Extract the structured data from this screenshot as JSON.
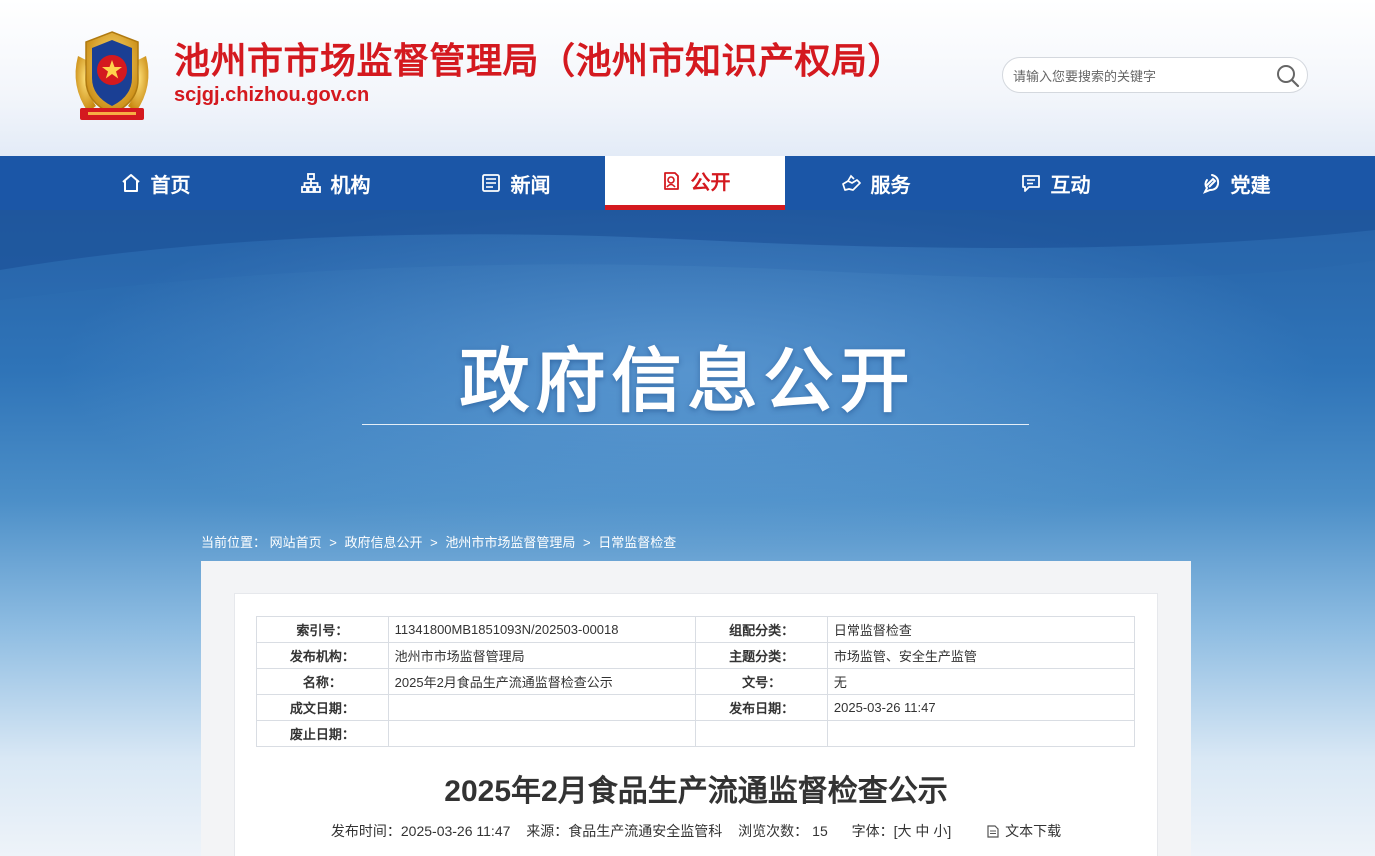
{
  "header": {
    "site_title": "池州市市场监督管理局（池州市知识产权局）",
    "site_url": "scjgj.chizhou.gov.cn",
    "search_placeholder": "请输入您要搜索的关键字"
  },
  "nav": {
    "items": [
      {
        "label": "首页",
        "icon": "home-icon"
      },
      {
        "label": "机构",
        "icon": "org-chart-icon"
      },
      {
        "label": "新闻",
        "icon": "newspaper-icon"
      },
      {
        "label": "公开",
        "icon": "open-info-icon",
        "active": true
      },
      {
        "label": "服务",
        "icon": "service-icon"
      },
      {
        "label": "互动",
        "icon": "chat-icon"
      },
      {
        "label": "党建",
        "icon": "party-icon"
      }
    ],
    "active_color": "#d4191f",
    "bar_color": "#1b56a7"
  },
  "banner": {
    "title": "政府信息公开"
  },
  "breadcrumb": {
    "prefix": "当前位置：",
    "items": [
      "网站首页",
      "政府信息公开",
      "池州市市场监督管理局",
      "日常监督检查"
    ],
    "separator": ">"
  },
  "meta_table": {
    "rows": [
      [
        {
          "k": "索引号：",
          "v": "11341800MB1851093N/202503-00018"
        },
        {
          "k": "组配分类：",
          "v": "日常监督检查"
        }
      ],
      [
        {
          "k": "发布机构：",
          "v": "池州市市场监督管理局"
        },
        {
          "k": "主题分类：",
          "v": "市场监管、安全生产监管"
        }
      ],
      [
        {
          "k": "名称：",
          "v": "2025年2月食品生产流通监督检查公示"
        },
        {
          "k": "文号：",
          "v": "无"
        }
      ],
      [
        {
          "k": "成文日期：",
          "v": ""
        },
        {
          "k": "发布日期：",
          "v": "2025-03-26 11:47"
        }
      ],
      [
        {
          "k": "废止日期：",
          "v": ""
        },
        {
          "k": "",
          "v": ""
        }
      ]
    ]
  },
  "article": {
    "title": "2025年2月食品生产流通监督检查公示",
    "publish_time": "发布时间：2025-03-26 11:47",
    "source": "来源：食品生产流通安全监管科",
    "views_label": "浏览次数：",
    "views": "15",
    "font_label": "字体：[",
    "font_large": "大",
    "font_medium": "中",
    "font_small": "小",
    "font_end": "]",
    "download": "文本下载"
  }
}
